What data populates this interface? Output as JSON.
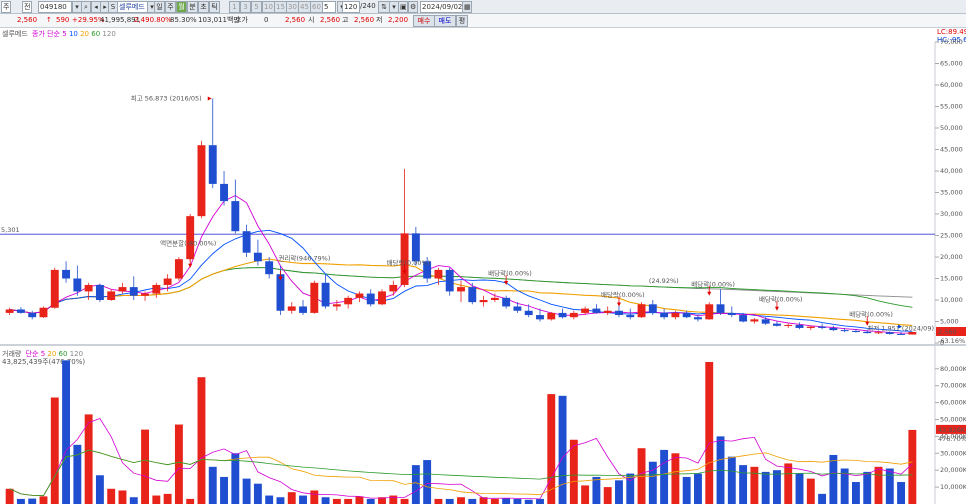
{
  "toolbar": {
    "market": "주",
    "period": "전",
    "code": "049180",
    "name": "셀루메드",
    "views": [
      "일",
      "주",
      "월",
      "분",
      "초",
      "틱"
    ],
    "active_view": "월",
    "intervals": [
      "1",
      "3",
      "5",
      "10",
      "15",
      "30",
      "45",
      "60"
    ],
    "interval_value": "5",
    "count": "120",
    "count_total": "/240",
    "date": "2024/09/02"
  },
  "quote": {
    "price": "2,560",
    "change": "590",
    "change_pct": "+29.95%",
    "volume": "41,995,891",
    "vol_ratio": "2,490.80%",
    "rate": "85.30%",
    "amount": "103,011백만",
    "hoga_label": "호가",
    "hoga": "0",
    "price2": "2,560",
    "open_label": "시",
    "open": "2,560",
    "high_label": "고",
    "high": "2,560",
    "low_label": "저",
    "low": "2,200",
    "buy": "매수",
    "sell": "매도",
    "extra": "평"
  },
  "price_panel": {
    "legend_name": "셀루메드",
    "legend_ma": "종가 단순",
    "ma_periods": [
      "5",
      "10",
      "20",
      "60",
      "120"
    ],
    "lc": "LC:89.49",
    "hc": "HC:-95.6",
    "hline_label": "5,301",
    "axis": [
      "70,000",
      "65,000",
      "60,000",
      "55,000",
      "50,000",
      "45,000",
      "40,000",
      "35,000",
      "30,000",
      "25,000",
      "20,000",
      "15,000",
      "10,000",
      "5,000",
      "0"
    ],
    "current_badge": "2,560",
    "badge_sub": "-63.16%",
    "ann_high": "최고 56,873 (2016/05)",
    "ann_low": "최저 1,951 (2024/09)",
    "ann_split": "액면분할(-80.00%)",
    "ann_rights": "권리락(946.79%)",
    "ann_div": "배당락(0.00%)",
    "ann_neg": "(24.92%)"
  },
  "volume_panel": {
    "legend_name": "거래량",
    "legend_ma": "단순",
    "ma_periods": [
      "5",
      "20",
      "60",
      "120"
    ],
    "legend_value": "43,825,439주(476.70%)",
    "axis": [
      "80,000K",
      "70,000K",
      "60,000K",
      "50,000K",
      "40,000K",
      "30,000K",
      "20,000K",
      "10,000K"
    ],
    "current_badge": "43,826K",
    "badge_sub": "476.70%"
  },
  "colors": {
    "up": "#e8231a",
    "down": "#1f4fd0",
    "ma5": "#d400d4",
    "ma10": "#0050ff",
    "ma20": "#f0a000",
    "ma60": "#2a9a2a",
    "ma120": "#888888"
  },
  "chart_data": {
    "type": "candlestick",
    "series": [
      {
        "name": "가격",
        "values": [
          [
            7000,
            8200,
            6500,
            7800
          ],
          [
            7800,
            8300,
            6800,
            7000
          ],
          [
            7000,
            7500,
            5500,
            6000
          ],
          [
            6000,
            8500,
            5800,
            8200
          ],
          [
            8200,
            17500,
            8000,
            17000
          ],
          [
            17000,
            19000,
            14000,
            15000
          ],
          [
            15000,
            18000,
            11000,
            12000
          ],
          [
            12000,
            14000,
            10000,
            13500
          ],
          [
            13500,
            13800,
            9500,
            10000
          ],
          [
            10000,
            12500,
            9800,
            12000
          ],
          [
            12000,
            14000,
            11500,
            13000
          ],
          [
            13000,
            15500,
            10000,
            11000
          ],
          [
            11000,
            12000,
            9800,
            11500
          ],
          [
            11500,
            14000,
            10500,
            13500
          ],
          [
            13500,
            16000,
            12000,
            15000
          ],
          [
            15000,
            20000,
            14500,
            19500
          ],
          [
            19500,
            30000,
            19000,
            29500
          ],
          [
            29500,
            47000,
            29000,
            46000
          ],
          [
            46000,
            56873,
            36000,
            37000
          ],
          [
            37000,
            40000,
            32000,
            33000
          ],
          [
            33000,
            38000,
            25500,
            26000
          ],
          [
            26000,
            27500,
            20000,
            21000
          ],
          [
            21000,
            24000,
            18000,
            19000
          ],
          [
            19000,
            20000,
            15000,
            16000
          ],
          [
            16000,
            18000,
            6500,
            7500
          ],
          [
            7500,
            9500,
            6800,
            8500
          ],
          [
            8500,
            10000,
            6500,
            7000
          ],
          [
            7000,
            14500,
            6800,
            14000
          ],
          [
            14000,
            16000,
            8000,
            8500
          ],
          [
            8500,
            10000,
            7500,
            9000
          ],
          [
            9000,
            11000,
            8000,
            10500
          ],
          [
            10500,
            12000,
            9500,
            11500
          ],
          [
            11500,
            12500,
            8500,
            9000
          ],
          [
            9000,
            12500,
            8800,
            12000
          ],
          [
            12000,
            14500,
            11000,
            13500
          ],
          [
            13500,
            40500,
            13000,
            25500
          ],
          [
            25500,
            27000,
            18000,
            19000
          ],
          [
            19000,
            20000,
            14000,
            15000
          ],
          [
            15000,
            17500,
            13500,
            17000
          ],
          [
            17000,
            17500,
            11000,
            12000
          ],
          [
            12000,
            14500,
            9500,
            13000
          ],
          [
            13000,
            14000,
            9000,
            9500
          ],
          [
            9500,
            11000,
            8500,
            10000
          ],
          [
            10000,
            11500,
            9500,
            10500
          ],
          [
            10500,
            11000,
            8000,
            8500
          ],
          [
            8500,
            9500,
            7000,
            7500
          ],
          [
            7500,
            9000,
            6000,
            6500
          ],
          [
            6500,
            8000,
            5000,
            5500
          ],
          [
            5500,
            7200,
            5200,
            7000
          ],
          [
            7000,
            8000,
            5700,
            6000
          ],
          [
            6000,
            7500,
            5500,
            7000
          ],
          [
            7000,
            8500,
            6500,
            8000
          ],
          [
            8000,
            9000,
            6800,
            7000
          ],
          [
            7000,
            8500,
            6500,
            7500
          ],
          [
            7500,
            9000,
            6000,
            6500
          ],
          [
            6500,
            8000,
            5500,
            6000
          ],
          [
            6000,
            9500,
            5800,
            9000
          ],
          [
            9000,
            10000,
            6500,
            7000
          ],
          [
            7000,
            8000,
            5500,
            6000
          ],
          [
            6000,
            7500,
            5500,
            7000
          ],
          [
            7000,
            7500,
            5800,
            6000
          ],
          [
            6000,
            6500,
            5000,
            5500
          ],
          [
            5500,
            9500,
            5400,
            9000
          ],
          [
            9000,
            12500,
            6500,
            7000
          ],
          [
            7000,
            8500,
            6000,
            6500
          ],
          [
            6500,
            7000,
            4800,
            5000
          ],
          [
            5000,
            5800,
            4500,
            5500
          ],
          [
            5500,
            6000,
            4200,
            4500
          ],
          [
            4500,
            5000,
            3800,
            4000
          ],
          [
            4000,
            4500,
            3500,
            4200
          ],
          [
            4200,
            4800,
            3200,
            3500
          ],
          [
            3500,
            4000,
            3000,
            3800
          ],
          [
            3800,
            4500,
            3200,
            3500
          ],
          [
            3500,
            4000,
            2800,
            3000
          ],
          [
            3000,
            3500,
            2500,
            2800
          ],
          [
            2800,
            3200,
            2400,
            2600
          ],
          [
            2600,
            3000,
            2200,
            2300
          ],
          [
            2300,
            2800,
            2100,
            2500
          ],
          [
            2500,
            2700,
            1951,
            2100
          ],
          [
            2100,
            2600,
            1951,
            1971
          ],
          [
            1971,
            2560,
            1951,
            2560
          ]
        ]
      },
      {
        "name": "거래량",
        "values": [
          9000,
          3000,
          3200,
          4500,
          63000,
          85000,
          35000,
          53000,
          17000,
          9000,
          8000,
          4000,
          44000,
          5000,
          6000,
          47000,
          3000,
          75000,
          22000,
          16000,
          30000,
          15000,
          12000,
          5000,
          4000,
          7000,
          5000,
          8000,
          4000,
          3000,
          3000,
          4500,
          3000,
          4000,
          5000,
          3000,
          23000,
          26000,
          3000,
          3000,
          4000,
          3000,
          4000,
          3000,
          3500,
          3000,
          2500,
          3000,
          65000,
          64000,
          38000,
          11000,
          16000,
          10000,
          14000,
          18000,
          33000,
          25000,
          32000,
          30000,
          16000,
          18000,
          84000,
          40000,
          28000,
          23000,
          22000,
          19000,
          20000,
          24000,
          18000,
          15000,
          6000,
          29000,
          21000,
          13000,
          19000,
          22000,
          21000,
          13000,
          43826
        ]
      }
    ]
  }
}
